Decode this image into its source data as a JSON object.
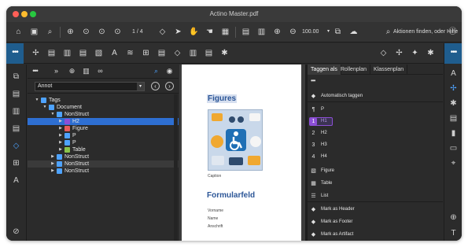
{
  "window": {
    "title": "Actino Master.pdf"
  },
  "toolbar": {
    "page_indicator": "1 / 4",
    "zoom_value": "100.00",
    "search_placeholder": "Aktionen finden, oder Hilfe",
    "icons": [
      "home-icon",
      "save-icon",
      "search-icon",
      "zoom-in-icon",
      "previous-page-icon",
      "next-page-icon",
      "tag-icon",
      "select-arrow-icon",
      "accessibility-touch-icon",
      "hand-icon",
      "table-icon",
      "document-icon",
      "zoom-in-icon",
      "zoom-out-icon",
      "compare-icon",
      "cloud-icon",
      "help-icon"
    ]
  },
  "toolbar2": {
    "dots": "•••",
    "dots_right": "•••"
  },
  "tags_panel": {
    "dots": "•••",
    "chevrons": "»",
    "select_value": "Annot",
    "tree": [
      {
        "label": "Tags",
        "level": 0,
        "state": "open"
      },
      {
        "label": "Document",
        "level": 1,
        "state": "open"
      },
      {
        "label": "NonStruct",
        "level": 2,
        "state": "open"
      },
      {
        "label": "H2",
        "level": 3,
        "state": "closed",
        "selected": true
      },
      {
        "label": "Figure",
        "level": 3,
        "state": "closed"
      },
      {
        "label": "P",
        "level": 3,
        "state": "closed"
      },
      {
        "label": "P",
        "level": 3,
        "state": "closed"
      },
      {
        "label": "Table",
        "level": 3,
        "state": "closed"
      },
      {
        "label": "NonStruct",
        "level": 2,
        "state": "closed"
      },
      {
        "label": "NonStruct",
        "level": 2,
        "state": "closed",
        "ghost": true
      },
      {
        "label": "NonStruct",
        "level": 2,
        "state": "closed"
      }
    ]
  },
  "document": {
    "heading_figures": "Figures",
    "caption": "Caption",
    "heading_form": "Formularfeld",
    "fields": [
      "Vorname",
      "Name",
      "Anschrift"
    ]
  },
  "right_panel": {
    "tabs": [
      "Taggen als",
      "Rollenplan",
      "Klassenplan"
    ],
    "dots": "•••",
    "items": [
      {
        "label": "Automatisch taggen",
        "icon": "tag-icon"
      },
      {
        "label": "P",
        "icon": "paragraph-icon"
      },
      {
        "label": "H1",
        "icon": "heading-1-icon",
        "active": true
      },
      {
        "label": "H2",
        "icon": "heading-2-icon"
      },
      {
        "label": "H3",
        "icon": "heading-3-icon"
      },
      {
        "label": "H4",
        "icon": "heading-4-icon"
      },
      {
        "label": "Figure",
        "icon": "image-icon"
      },
      {
        "label": "Table",
        "icon": "table-icon"
      },
      {
        "label": "List",
        "icon": "list-icon"
      },
      {
        "label": "Mark as Header",
        "icon": "tag-icon"
      },
      {
        "label": "Mark as Footer",
        "icon": "tag-icon"
      },
      {
        "label": "Mark as Artifact",
        "icon": "tag-icon"
      }
    ]
  },
  "colors": {
    "accent_blue": "#2e6fd2",
    "panel_dark": "#2b2b2b",
    "heading_blue": "#2c5697",
    "active_purple": "#8c4fd6"
  }
}
